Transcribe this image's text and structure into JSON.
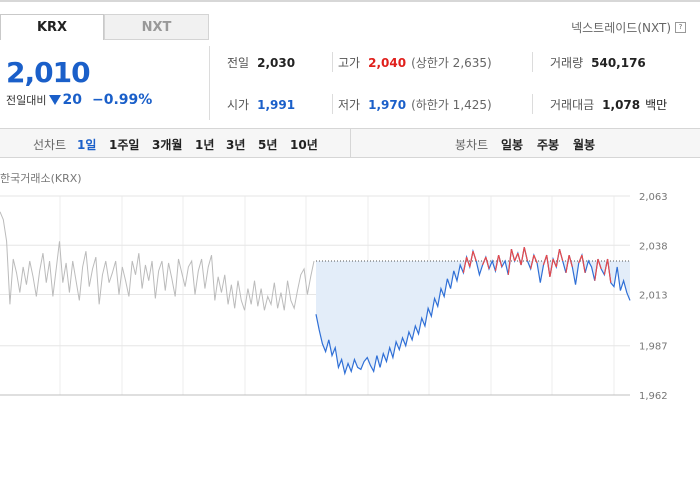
{
  "tabs": [
    {
      "label": "KRX",
      "active": true
    },
    {
      "label": "NXT",
      "active": false
    }
  ],
  "nxt_link": {
    "label": "넥스트레이드(NXT)",
    "icon": "help-icon"
  },
  "quote": {
    "price": "2,010",
    "change_label": "전일대비",
    "change_direction": "down",
    "change_amount": "20",
    "change_percent": "−0.99%"
  },
  "stats": {
    "prev_close": {
      "label": "전일",
      "value": "2,030"
    },
    "high": {
      "label": "고가",
      "value": "2,040",
      "limit_text": "(상한가 2,635)"
    },
    "volume": {
      "label": "거래량",
      "value": "540,176"
    },
    "open": {
      "label": "시가",
      "value": "1,991"
    },
    "low": {
      "label": "저가",
      "value": "1,970",
      "limit_text": "(하한가 1,425)"
    },
    "amount": {
      "label": "거래대금",
      "value": "1,078",
      "unit": "백만"
    }
  },
  "toolbar": {
    "line_label": "선차트",
    "line_periods": [
      "1일",
      "1주일",
      "3개월",
      "1년",
      "3년",
      "5년",
      "10년"
    ],
    "active_period": "1일",
    "candle_label": "봉차트",
    "candle_periods": [
      "일봉",
      "주봉",
      "월봉"
    ]
  },
  "chart_source": "한국거래소(KRX)",
  "chart_data": {
    "type": "line",
    "y_ticks": [
      "2,063",
      "2,038",
      "2,013",
      "1,987",
      "1,962"
    ],
    "ylim": [
      1962,
      2063
    ],
    "reference_line": 2030,
    "grid": true,
    "colors": {
      "previous_day": "#bbbbbb",
      "today": "#2f6fd6",
      "above_reference": "#e84a4a",
      "fill": "#e3edf9"
    },
    "series": [
      {
        "values": [
          2055,
          2051,
          2040,
          2008,
          2031,
          2024,
          2014,
          2027,
          2018,
          2030,
          2022,
          2012,
          2025,
          2034,
          2019,
          2030,
          2012,
          2026,
          2040,
          2019,
          2029,
          2014,
          2030,
          2020,
          2010,
          2027,
          2035,
          2017,
          2026,
          2032,
          2008,
          2023,
          2030,
          2019,
          2024,
          2030,
          2013,
          2027,
          2020,
          2012,
          2030,
          2023,
          2034,
          2016,
          2028,
          2020,
          2030,
          2011,
          2025,
          2030,
          2015,
          2029,
          2021,
          2012,
          2031,
          2024,
          2017,
          2027,
          2030,
          2013,
          2025,
          2031,
          2016,
          2027,
          2033,
          2010,
          2022,
          2014,
          2023,
          2008,
          2018,
          2006,
          2020,
          2010,
          2005,
          2016,
          2008,
          2020,
          2007,
          2016,
          2005,
          2012,
          2008,
          2019,
          2006,
          2014,
          2005,
          2020,
          2010,
          2006,
          2015,
          2023,
          2026,
          2013,
          2022,
          2030
        ]
      },
      {
        "values": [
          2003,
          1995,
          1988,
          1984,
          1990,
          1982,
          1986,
          1976,
          1980,
          1973,
          1978,
          1974,
          1980,
          1976,
          1975,
          1979,
          1981,
          1977,
          1974,
          1982,
          1976,
          1983,
          1979,
          1986,
          1981,
          1989,
          1985,
          1991,
          1987,
          1994,
          1990,
          1997,
          1993,
          2001,
          1997,
          2006,
          2002,
          2011,
          2007,
          2016,
          2012,
          2021,
          2016,
          2025,
          2020,
          2028,
          2024,
          2032,
          2027,
          2035,
          2030,
          2023,
          2028,
          2032,
          2026,
          2030,
          2025,
          2033,
          2027,
          2030,
          2023,
          2036,
          2030,
          2034,
          2028,
          2037,
          2030,
          2026,
          2033,
          2029,
          2019,
          2028,
          2033,
          2022,
          2031,
          2027,
          2036,
          2030,
          2024,
          2033,
          2027,
          2018,
          2029,
          2033,
          2024,
          2030,
          2027,
          2020,
          2031,
          2026,
          2023,
          2031,
          2019,
          2017,
          2027,
          2015,
          2020,
          2014,
          2010
        ]
      }
    ]
  }
}
